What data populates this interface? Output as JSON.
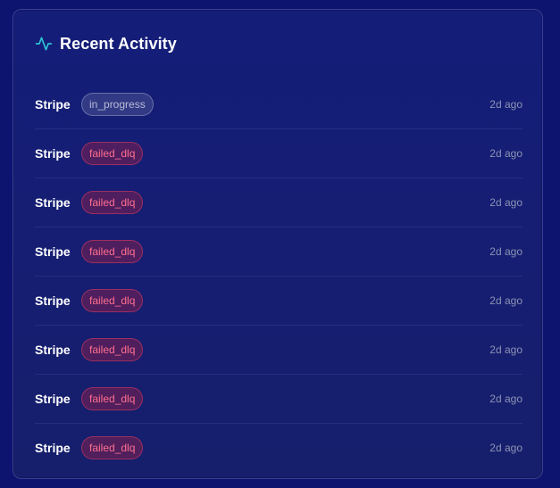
{
  "card": {
    "title": "Recent Activity",
    "icon": "activity-pulse-icon",
    "accent_color": "#2ec4d6"
  },
  "activity": [
    {
      "source": "Stripe",
      "status": "in_progress",
      "status_kind": "progress",
      "time": "2d ago"
    },
    {
      "source": "Stripe",
      "status": "failed_dlq",
      "status_kind": "failed",
      "time": "2d ago"
    },
    {
      "source": "Stripe",
      "status": "failed_dlq",
      "status_kind": "failed",
      "time": "2d ago"
    },
    {
      "source": "Stripe",
      "status": "failed_dlq",
      "status_kind": "failed",
      "time": "2d ago"
    },
    {
      "source": "Stripe",
      "status": "failed_dlq",
      "status_kind": "failed",
      "time": "2d ago"
    },
    {
      "source": "Stripe",
      "status": "failed_dlq",
      "status_kind": "failed",
      "time": "2d ago"
    },
    {
      "source": "Stripe",
      "status": "failed_dlq",
      "status_kind": "failed",
      "time": "2d ago"
    },
    {
      "source": "Stripe",
      "status": "failed_dlq",
      "status_kind": "failed",
      "time": "2d ago"
    }
  ],
  "colors": {
    "background": "#0d1470",
    "failed_text": "#ff6f8e",
    "progress_text": "#b8bcd4",
    "muted_text": "#8d93b4"
  }
}
